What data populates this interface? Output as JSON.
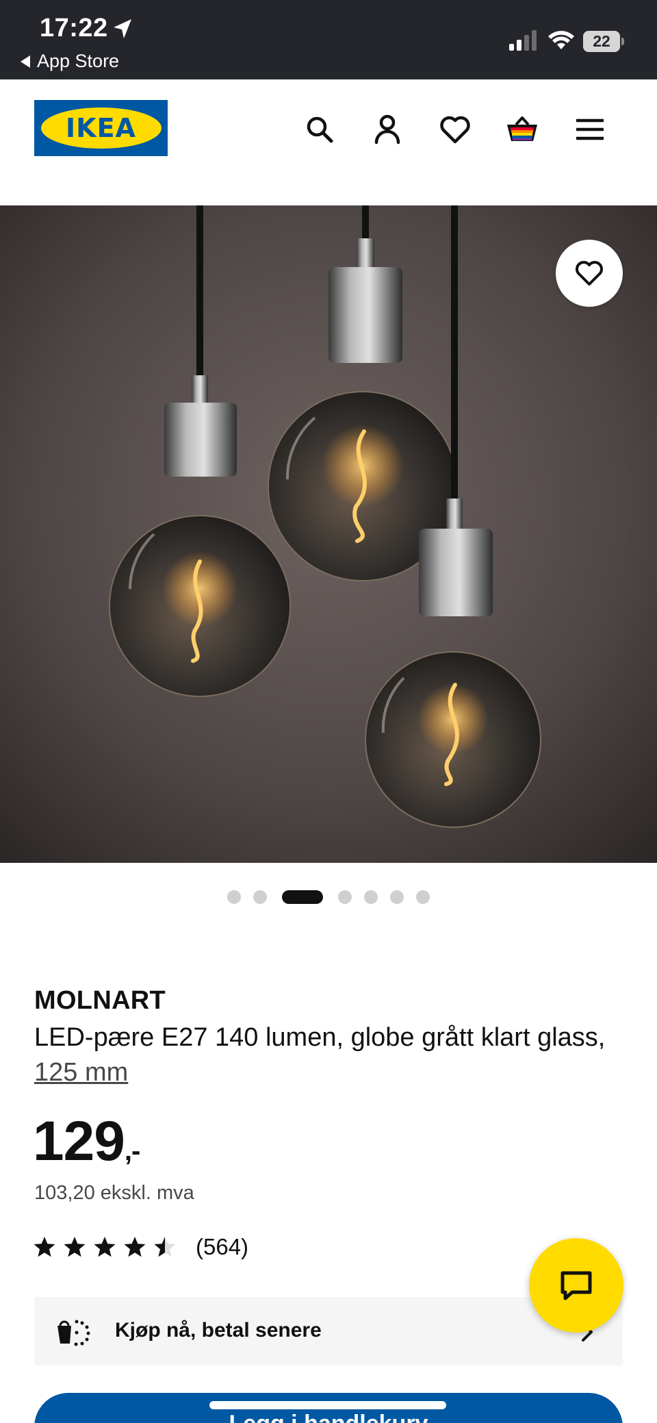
{
  "status_bar": {
    "time": "17:22",
    "back_label": "App Store",
    "battery": "22"
  },
  "header": {
    "logo_text": "IKEA",
    "icons": [
      "search-icon",
      "account-icon",
      "favourites-icon",
      "cart-icon",
      "menu-icon"
    ]
  },
  "gallery": {
    "total_images": 7,
    "active_index": 2
  },
  "product": {
    "name": "MOLNART",
    "description": "LED-pære E27 140 lumen, globe grått klart glass,",
    "size": "125 mm",
    "price_main": "129",
    "price_suffix": ",-",
    "price_ex_vat": "103,20 ekskl. mva",
    "rating_value": 4.5,
    "rating_max": 5,
    "review_count": "(564)"
  },
  "pay_later": {
    "label": "Kjøp nå, betal senere"
  },
  "add_to_cart": {
    "label": "Legg i handlekurv"
  },
  "colors": {
    "ikea_blue": "#0058a3",
    "ikea_yellow": "#ffdb00",
    "status_bar_bg": "#25262b"
  }
}
